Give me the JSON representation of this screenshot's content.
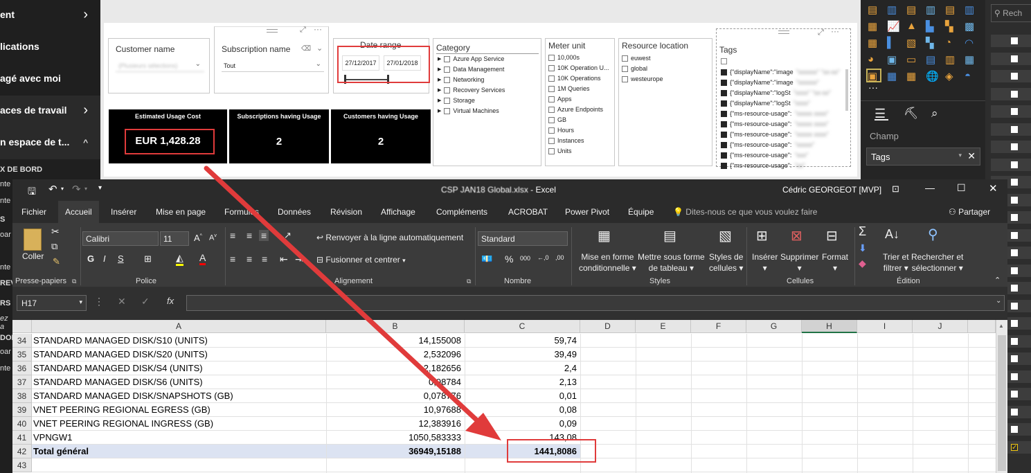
{
  "pbi": {
    "nav": [
      {
        "label": "ent",
        "chevron": "›"
      },
      {
        "label": "lications",
        "chevron": ""
      },
      {
        "label": "agé avec moi",
        "chevron": ""
      },
      {
        "label": "aces de travail",
        "chevron": "›"
      },
      {
        "label": "n espace de t...",
        "chevron": "^"
      }
    ],
    "nav_sections": [
      "X DE BORD",
      "nte",
      "nte",
      "S",
      "oar",
      "nte",
      "REV",
      "RS",
      "ez a",
      "DON",
      "oar",
      "nte"
    ],
    "slicers": {
      "customer": {
        "title": "Customer name",
        "placeholder": "(Plusieurs sélections)"
      },
      "subscription": {
        "title": "Subscription name",
        "value": "Tout"
      },
      "date": {
        "title": "Date range",
        "start": "27/12/2017",
        "end": "27/01/2018"
      },
      "category": {
        "title": "Category",
        "items": [
          "Azure App Service",
          "Data Management",
          "Networking",
          "Recovery Services",
          "Storage",
          "Virtual Machines"
        ]
      },
      "meter": {
        "title": "Meter unit",
        "items": [
          "10,000s",
          "10K Operation U...",
          "10K Operations",
          "1M Queries",
          "Apps",
          "Azure Endpoints",
          "GB",
          "Hours",
          "Instances",
          "Units"
        ]
      },
      "location": {
        "title": "Resource location",
        "items": [
          "euwest",
          "global",
          "westeurope"
        ]
      },
      "tags": {
        "title": "Tags",
        "items": [
          "{\"displayName\":\"image",
          "{\"displayName\":\"image",
          "{\"displayName\":\"logSt",
          "{\"displayName\":\"logSt",
          "{\"ms-resource-usage\":",
          "{\"ms-resource-usage\":",
          "{\"ms-resource-usage\":",
          "{\"ms-resource-usage\":",
          "{\"ms-resource-usage\":",
          "{\"ms-resource-usage\":"
        ]
      }
    },
    "cards": [
      {
        "title": "Estimated Usage Cost",
        "value": "EUR 1,428.28"
      },
      {
        "title": "Subscriptions having Usage",
        "value": "2"
      },
      {
        "title": "Customers having Usage",
        "value": "2"
      }
    ],
    "right_panel": {
      "champ_label": "Champ",
      "field_value": "Tags",
      "search_label": "Rech"
    }
  },
  "excel": {
    "title": "CSP JAN18 Global.xlsx",
    "app": "Excel",
    "user": "Cédric GEORGEOT [MVP]",
    "tabs": [
      "Fichier",
      "Accueil",
      "Insérer",
      "Mise en page",
      "Formules",
      "Données",
      "Révision",
      "Affichage",
      "Compléments",
      "ACROBAT",
      "Power Pivot",
      "Équipe"
    ],
    "tell_me": "Dites-nous ce que vous voulez faire",
    "share": "Partager",
    "ribbon": {
      "paste": "Coller",
      "font": "Calibri",
      "size": "11",
      "wrap": "Renvoyer à la ligne automatiquement",
      "merge": "Fusionner et centrer",
      "number_format": "Standard",
      "cond_format": [
        "Mise en forme",
        "conditionnelle"
      ],
      "table_format": [
        "Mettre sous forme",
        "de tableau"
      ],
      "cell_styles": [
        "Styles de",
        "cellules"
      ],
      "insert": "Insérer",
      "delete": "Supprimer",
      "format": "Format",
      "sort": [
        "Trier et",
        "filtrer"
      ],
      "find": [
        "Rechercher et",
        "sélectionner"
      ],
      "groups": [
        "Presse-papiers",
        "Police",
        "Alignement",
        "Nombre",
        "Styles",
        "Cellules",
        "Édition"
      ]
    },
    "name_box": "H17",
    "columns": [
      "A",
      "B",
      "C",
      "D",
      "E",
      "F",
      "G",
      "H",
      "I",
      "J"
    ],
    "rows": [
      {
        "n": "34",
        "a": "STANDARD MANAGED DISK/S10 (UNITS)",
        "b": "14,155008",
        "c": "59,74"
      },
      {
        "n": "35",
        "a": "STANDARD MANAGED DISK/S20 (UNITS)",
        "b": "2,532096",
        "c": "39,49"
      },
      {
        "n": "36",
        "a": "STANDARD MANAGED DISK/S4 (UNITS)",
        "b": "2,182656",
        "c": "2,4"
      },
      {
        "n": "37",
        "a": "STANDARD MANAGED DISK/S6 (UNITS)",
        "b": "0,98784",
        "c": "2,13"
      },
      {
        "n": "38",
        "a": "STANDARD MANAGED DISK/SNAPSHOTS (GB)",
        "b": "0,078776",
        "c": "0,01"
      },
      {
        "n": "39",
        "a": "VNET PEERING REGIONAL EGRESS (GB)",
        "b": "10,97688",
        "c": "0,08"
      },
      {
        "n": "40",
        "a": "VNET PEERING REGIONAL INGRESS (GB)",
        "b": "12,383916",
        "c": "0,09"
      },
      {
        "n": "41",
        "a": "VPNGW1",
        "b": "1050,583333",
        "c": "143,08"
      },
      {
        "n": "42",
        "a": "Total général",
        "b": "36949,15188",
        "c": "1441,8086"
      },
      {
        "n": "43",
        "a": "",
        "b": "",
        "c": ""
      }
    ]
  },
  "colors": {
    "annotation": "#e03b3b",
    "excel_dark": "#2b2b2b",
    "total_row": "#dce3f2"
  }
}
